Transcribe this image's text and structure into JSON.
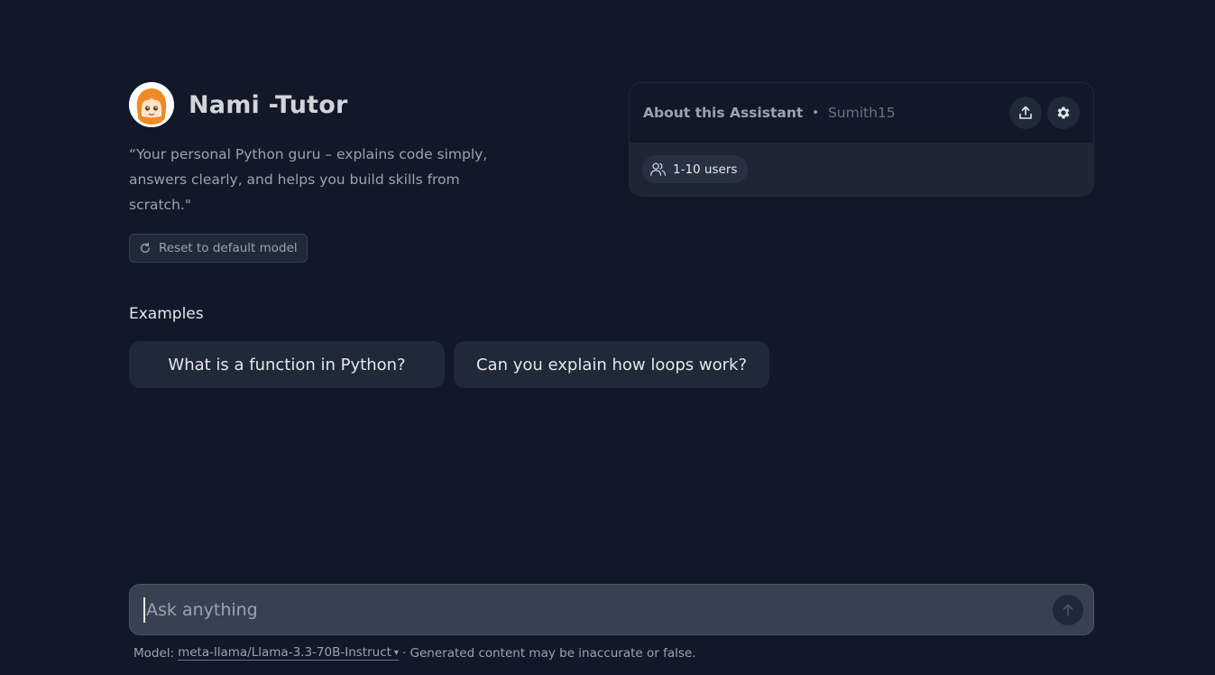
{
  "assistant": {
    "name": "Nami -Tutor",
    "description": "“Your personal Python guru – explains code simply, answers clearly, and helps you build skills from scratch.\"",
    "reset_label": "Reset to default model"
  },
  "about": {
    "title": "About this Assistant",
    "separator": "•",
    "author": "Sumith15",
    "users": "1-10 users",
    "icons": [
      "share-icon",
      "gear-icon",
      "users-icon"
    ]
  },
  "examples": {
    "label": "Examples",
    "items": [
      "What is a function in Python?",
      "Can you explain how loops work?"
    ]
  },
  "chat": {
    "placeholder": "Ask anything"
  },
  "footer": {
    "model_prefix": "Model:",
    "model_name": "meta-llama/Llama-3.3-70B-Instruct",
    "caret": "▾",
    "note": "· Generated content may be inaccurate or false."
  },
  "colors": {
    "background": "#111827",
    "card": "#1f2937",
    "input": "#374151",
    "text_muted": "#9ca3af"
  }
}
